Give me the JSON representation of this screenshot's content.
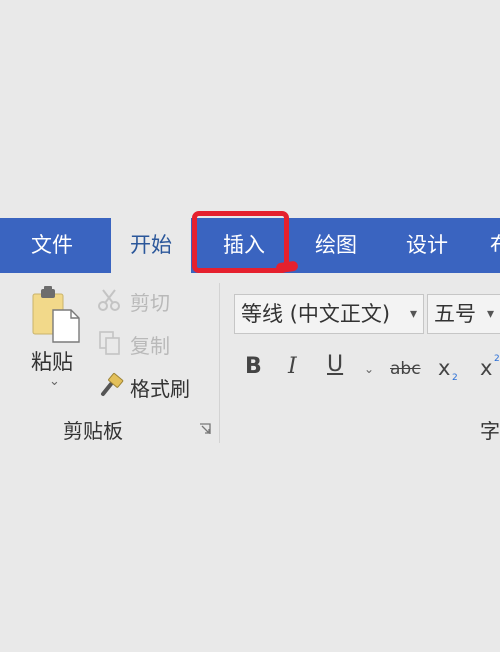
{
  "tabs": [
    {
      "label": "文件",
      "active": false
    },
    {
      "label": "开始",
      "active": true
    },
    {
      "label": "插入",
      "active": false,
      "highlighted": true
    },
    {
      "label": "绘图",
      "active": false
    },
    {
      "label": "设计",
      "active": false
    },
    {
      "label": "布",
      "active": false
    }
  ],
  "clipboard": {
    "paste_label": "粘贴",
    "cut_label": "剪切",
    "copy_label": "复制",
    "format_painter_label": "格式刷",
    "group_label": "剪贴板"
  },
  "font": {
    "font_name": "等线 (中文正文)",
    "font_size": "五号",
    "group_label": "字"
  },
  "format_buttons": {
    "bold": "B",
    "italic": "I",
    "underline": "U",
    "strikethrough": "abc",
    "subscript": "x",
    "superscript": "x"
  },
  "colors": {
    "tab_bar": "#3a64c0",
    "active_tab_text": "#2b579a",
    "annotation_red": "#e5202e"
  }
}
